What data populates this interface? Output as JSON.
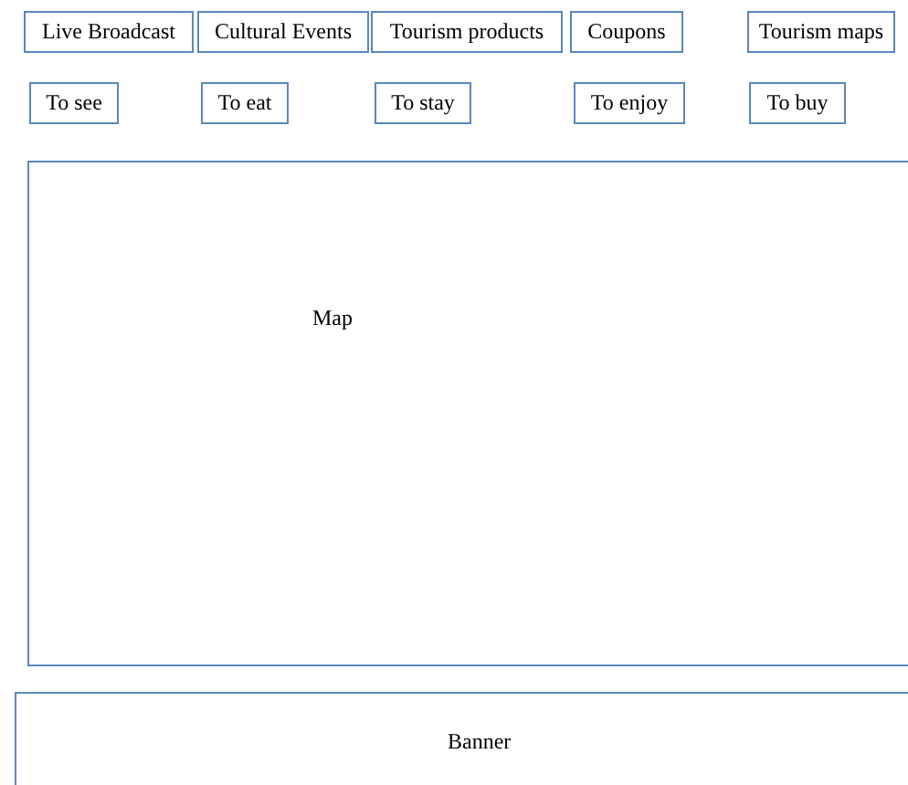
{
  "top_tabs": [
    {
      "label": "Live Broadcast"
    },
    {
      "label": "Cultural Events"
    },
    {
      "label": "Tourism products"
    },
    {
      "label": "Coupons"
    },
    {
      "label": "Tourism maps"
    }
  ],
  "categories": [
    {
      "label": "To see"
    },
    {
      "label": "To eat"
    },
    {
      "label": "To stay"
    },
    {
      "label": "To enjoy"
    },
    {
      "label": "To buy"
    }
  ],
  "map": {
    "label": "Map"
  },
  "banner": {
    "label": "Banner"
  }
}
